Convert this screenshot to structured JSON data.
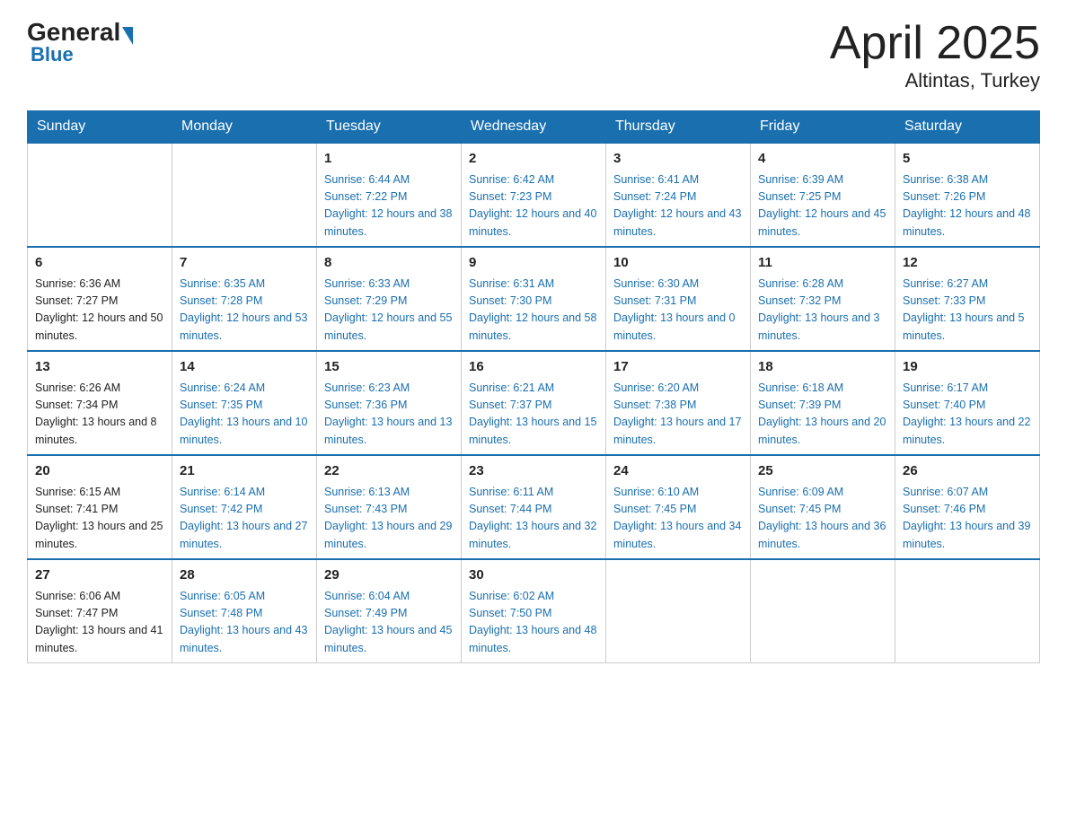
{
  "header": {
    "logo_general": "General",
    "logo_blue": "Blue",
    "title": "April 2025",
    "subtitle": "Altintas, Turkey"
  },
  "days_of_week": [
    "Sunday",
    "Monday",
    "Tuesday",
    "Wednesday",
    "Thursday",
    "Friday",
    "Saturday"
  ],
  "weeks": [
    [
      {
        "day": "",
        "sunrise": "",
        "sunset": "",
        "daylight": ""
      },
      {
        "day": "",
        "sunrise": "",
        "sunset": "",
        "daylight": ""
      },
      {
        "day": "1",
        "sunrise": "Sunrise: 6:44 AM",
        "sunset": "Sunset: 7:22 PM",
        "daylight": "Daylight: 12 hours and 38 minutes."
      },
      {
        "day": "2",
        "sunrise": "Sunrise: 6:42 AM",
        "sunset": "Sunset: 7:23 PM",
        "daylight": "Daylight: 12 hours and 40 minutes."
      },
      {
        "day": "3",
        "sunrise": "Sunrise: 6:41 AM",
        "sunset": "Sunset: 7:24 PM",
        "daylight": "Daylight: 12 hours and 43 minutes."
      },
      {
        "day": "4",
        "sunrise": "Sunrise: 6:39 AM",
        "sunset": "Sunset: 7:25 PM",
        "daylight": "Daylight: 12 hours and 45 minutes."
      },
      {
        "day": "5",
        "sunrise": "Sunrise: 6:38 AM",
        "sunset": "Sunset: 7:26 PM",
        "daylight": "Daylight: 12 hours and 48 minutes."
      }
    ],
    [
      {
        "day": "6",
        "sunrise": "Sunrise: 6:36 AM",
        "sunset": "Sunset: 7:27 PM",
        "daylight": "Daylight: 12 hours and 50 minutes."
      },
      {
        "day": "7",
        "sunrise": "Sunrise: 6:35 AM",
        "sunset": "Sunset: 7:28 PM",
        "daylight": "Daylight: 12 hours and 53 minutes."
      },
      {
        "day": "8",
        "sunrise": "Sunrise: 6:33 AM",
        "sunset": "Sunset: 7:29 PM",
        "daylight": "Daylight: 12 hours and 55 minutes."
      },
      {
        "day": "9",
        "sunrise": "Sunrise: 6:31 AM",
        "sunset": "Sunset: 7:30 PM",
        "daylight": "Daylight: 12 hours and 58 minutes."
      },
      {
        "day": "10",
        "sunrise": "Sunrise: 6:30 AM",
        "sunset": "Sunset: 7:31 PM",
        "daylight": "Daylight: 13 hours and 0 minutes."
      },
      {
        "day": "11",
        "sunrise": "Sunrise: 6:28 AM",
        "sunset": "Sunset: 7:32 PM",
        "daylight": "Daylight: 13 hours and 3 minutes."
      },
      {
        "day": "12",
        "sunrise": "Sunrise: 6:27 AM",
        "sunset": "Sunset: 7:33 PM",
        "daylight": "Daylight: 13 hours and 5 minutes."
      }
    ],
    [
      {
        "day": "13",
        "sunrise": "Sunrise: 6:26 AM",
        "sunset": "Sunset: 7:34 PM",
        "daylight": "Daylight: 13 hours and 8 minutes."
      },
      {
        "day": "14",
        "sunrise": "Sunrise: 6:24 AM",
        "sunset": "Sunset: 7:35 PM",
        "daylight": "Daylight: 13 hours and 10 minutes."
      },
      {
        "day": "15",
        "sunrise": "Sunrise: 6:23 AM",
        "sunset": "Sunset: 7:36 PM",
        "daylight": "Daylight: 13 hours and 13 minutes."
      },
      {
        "day": "16",
        "sunrise": "Sunrise: 6:21 AM",
        "sunset": "Sunset: 7:37 PM",
        "daylight": "Daylight: 13 hours and 15 minutes."
      },
      {
        "day": "17",
        "sunrise": "Sunrise: 6:20 AM",
        "sunset": "Sunset: 7:38 PM",
        "daylight": "Daylight: 13 hours and 17 minutes."
      },
      {
        "day": "18",
        "sunrise": "Sunrise: 6:18 AM",
        "sunset": "Sunset: 7:39 PM",
        "daylight": "Daylight: 13 hours and 20 minutes."
      },
      {
        "day": "19",
        "sunrise": "Sunrise: 6:17 AM",
        "sunset": "Sunset: 7:40 PM",
        "daylight": "Daylight: 13 hours and 22 minutes."
      }
    ],
    [
      {
        "day": "20",
        "sunrise": "Sunrise: 6:15 AM",
        "sunset": "Sunset: 7:41 PM",
        "daylight": "Daylight: 13 hours and 25 minutes."
      },
      {
        "day": "21",
        "sunrise": "Sunrise: 6:14 AM",
        "sunset": "Sunset: 7:42 PM",
        "daylight": "Daylight: 13 hours and 27 minutes."
      },
      {
        "day": "22",
        "sunrise": "Sunrise: 6:13 AM",
        "sunset": "Sunset: 7:43 PM",
        "daylight": "Daylight: 13 hours and 29 minutes."
      },
      {
        "day": "23",
        "sunrise": "Sunrise: 6:11 AM",
        "sunset": "Sunset: 7:44 PM",
        "daylight": "Daylight: 13 hours and 32 minutes."
      },
      {
        "day": "24",
        "sunrise": "Sunrise: 6:10 AM",
        "sunset": "Sunset: 7:45 PM",
        "daylight": "Daylight: 13 hours and 34 minutes."
      },
      {
        "day": "25",
        "sunrise": "Sunrise: 6:09 AM",
        "sunset": "Sunset: 7:45 PM",
        "daylight": "Daylight: 13 hours and 36 minutes."
      },
      {
        "day": "26",
        "sunrise": "Sunrise: 6:07 AM",
        "sunset": "Sunset: 7:46 PM",
        "daylight": "Daylight: 13 hours and 39 minutes."
      }
    ],
    [
      {
        "day": "27",
        "sunrise": "Sunrise: 6:06 AM",
        "sunset": "Sunset: 7:47 PM",
        "daylight": "Daylight: 13 hours and 41 minutes."
      },
      {
        "day": "28",
        "sunrise": "Sunrise: 6:05 AM",
        "sunset": "Sunset: 7:48 PM",
        "daylight": "Daylight: 13 hours and 43 minutes."
      },
      {
        "day": "29",
        "sunrise": "Sunrise: 6:04 AM",
        "sunset": "Sunset: 7:49 PM",
        "daylight": "Daylight: 13 hours and 45 minutes."
      },
      {
        "day": "30",
        "sunrise": "Sunrise: 6:02 AM",
        "sunset": "Sunset: 7:50 PM",
        "daylight": "Daylight: 13 hours and 48 minutes."
      },
      {
        "day": "",
        "sunrise": "",
        "sunset": "",
        "daylight": ""
      },
      {
        "day": "",
        "sunrise": "",
        "sunset": "",
        "daylight": ""
      },
      {
        "day": "",
        "sunrise": "",
        "sunset": "",
        "daylight": ""
      }
    ]
  ]
}
